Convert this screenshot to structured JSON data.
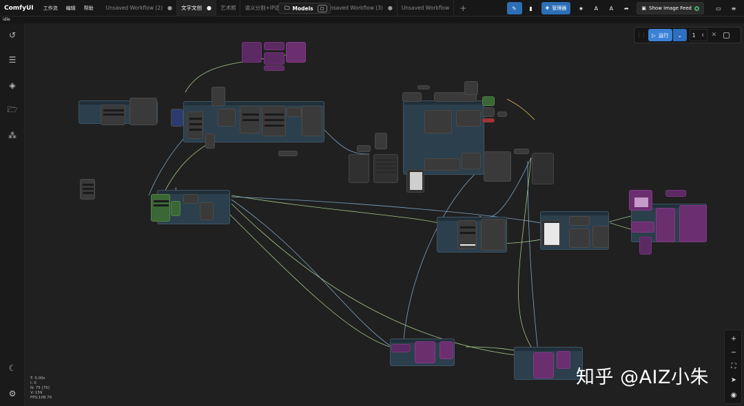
{
  "app": {
    "name": "ComfyUI",
    "status": "idle"
  },
  "menu": [
    "工作流",
    "编辑",
    "帮助"
  ],
  "tabs": [
    {
      "label": "Unsaved Workflow (2)",
      "active": false
    },
    {
      "label": "文字文创",
      "active": true
    },
    {
      "label": "艺术照",
      "active": false
    },
    {
      "label": "语义分割+IP适配",
      "active": false
    },
    {
      "label": "Unsaved Workflow (3)",
      "active": false
    },
    {
      "label": "Unsaved Workflow",
      "active": false
    }
  ],
  "toolbar": {
    "models_label": "Models",
    "manager_label": "管理器",
    "feed_label": "Show Image Feed",
    "add_tab_icon": "plus-icon"
  },
  "run": {
    "label": "运行",
    "count": "1"
  },
  "stats": {
    "t": "T: 0.00s",
    "i": "I: 0",
    "n": "N: 75 [75]",
    "v": "V: 159",
    "fps": "FPS:108.70"
  },
  "watermark": "知乎 @AIZ小朱",
  "colors": {
    "canvas_bg": "#202020",
    "accent_blue": "#3b82d6",
    "node_blue": "#2c3f4c",
    "node_purple": "#5c2a63",
    "node_green": "#3b6636",
    "link_green": "#a6c98a",
    "link_blue": "#7fa6c7"
  }
}
